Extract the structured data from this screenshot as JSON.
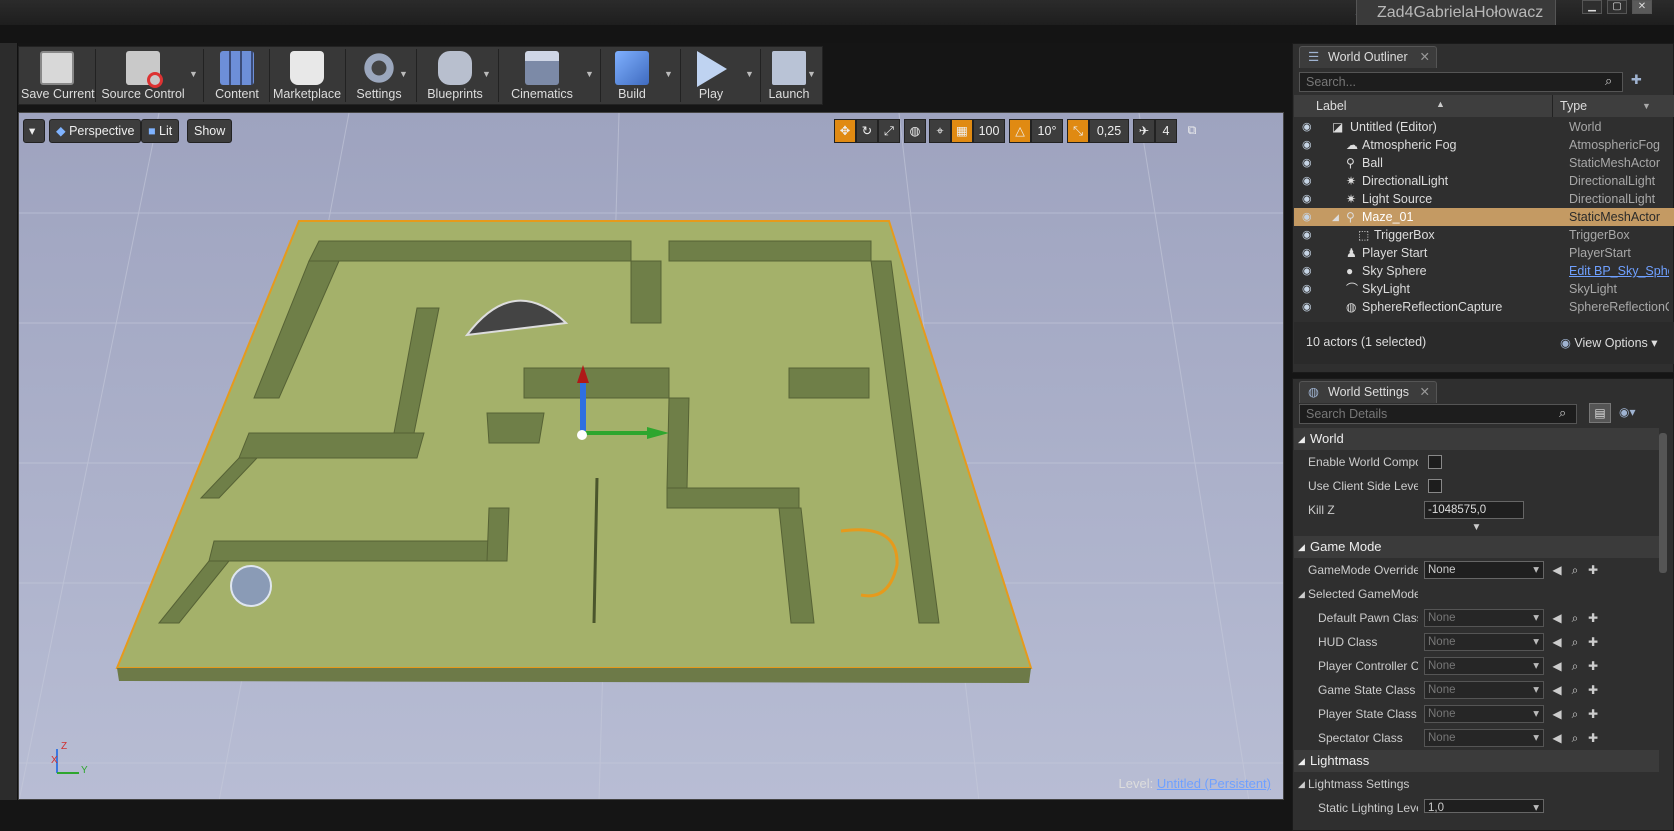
{
  "window": {
    "title": "Zad4GabrielaHołowacz"
  },
  "toolbar": {
    "buttons": [
      {
        "label": "Save Current",
        "icon": "floppy-disk-icon"
      },
      {
        "label": "Source Control",
        "icon": "source-control-icon"
      },
      {
        "label": "Content",
        "icon": "content-browser-icon"
      },
      {
        "label": "Marketplace",
        "icon": "marketplace-icon"
      },
      {
        "label": "Settings",
        "icon": "gear-icon"
      },
      {
        "label": "Blueprints",
        "icon": "gamepad-icon"
      },
      {
        "label": "Cinematics",
        "icon": "clapperboard-icon"
      },
      {
        "label": "Build",
        "icon": "build-blocks-icon"
      },
      {
        "label": "Play",
        "icon": "play-icon"
      },
      {
        "label": "Launch",
        "icon": "launch-icon"
      }
    ]
  },
  "viewport": {
    "perspective_label": "Perspective",
    "lit_label": "Lit",
    "show_label": "Show",
    "grid_snap": "100",
    "rotation_snap": "10°",
    "scale_snap": "0,25",
    "camera_speed": "4",
    "level_label": "Level:",
    "level_value": "Untitled (Persistent)",
    "axis_x": "X",
    "axis_y": "Y",
    "axis_z": "Z"
  },
  "outliner": {
    "tab": "World Outliner",
    "search_placeholder": "Search...",
    "col_label": "Label",
    "col_type": "Type",
    "rows": [
      {
        "label": "Untitled (Editor)",
        "type": "World"
      },
      {
        "label": "Atmospheric Fog",
        "type": "AtmosphericFog"
      },
      {
        "label": "Ball",
        "type": "StaticMeshActor"
      },
      {
        "label": "DirectionalLight",
        "type": "DirectionalLight"
      },
      {
        "label": "Light Source",
        "type": "DirectionalLight"
      },
      {
        "label": "Maze_01",
        "type": "StaticMeshActor"
      },
      {
        "label": "TriggerBox",
        "type": "TriggerBox"
      },
      {
        "label": "Player Start",
        "type": "PlayerStart"
      },
      {
        "label": "Sky Sphere",
        "type": "Edit BP_Sky_Sphere"
      },
      {
        "label": "SkyLight",
        "type": "SkyLight"
      },
      {
        "label": "SphereReflectionCapture",
        "type": "SphereReflectionCapture"
      }
    ],
    "footer_count": "10 actors (1 selected)",
    "view_options": "View Options"
  },
  "world_settings": {
    "tab": "World Settings",
    "search_placeholder": "Search Details",
    "world_section": "World",
    "enable_world_composition": "Enable World Composi",
    "use_client_side": "Use Client Side Level S",
    "kill_z_label": "Kill Z",
    "kill_z_value": "-1048575,0",
    "game_mode_section": "Game Mode",
    "gamemode_override_label": "GameMode Override",
    "gamemode_override_value": "None",
    "selected_gamemode": "Selected GameMode",
    "props": [
      {
        "label": "Default Pawn Class",
        "value": "None"
      },
      {
        "label": "HUD Class",
        "value": "None"
      },
      {
        "label": "Player Controller Cla",
        "value": "None"
      },
      {
        "label": "Game State Class",
        "value": "None"
      },
      {
        "label": "Player State Class",
        "value": "None"
      },
      {
        "label": "Spectator Class",
        "value": "None"
      }
    ],
    "lightmass_section": "Lightmass",
    "lightmass_settings": "Lightmass Settings",
    "static_lighting_label": "Static Lighting Leve",
    "static_lighting_value": "1,0"
  }
}
